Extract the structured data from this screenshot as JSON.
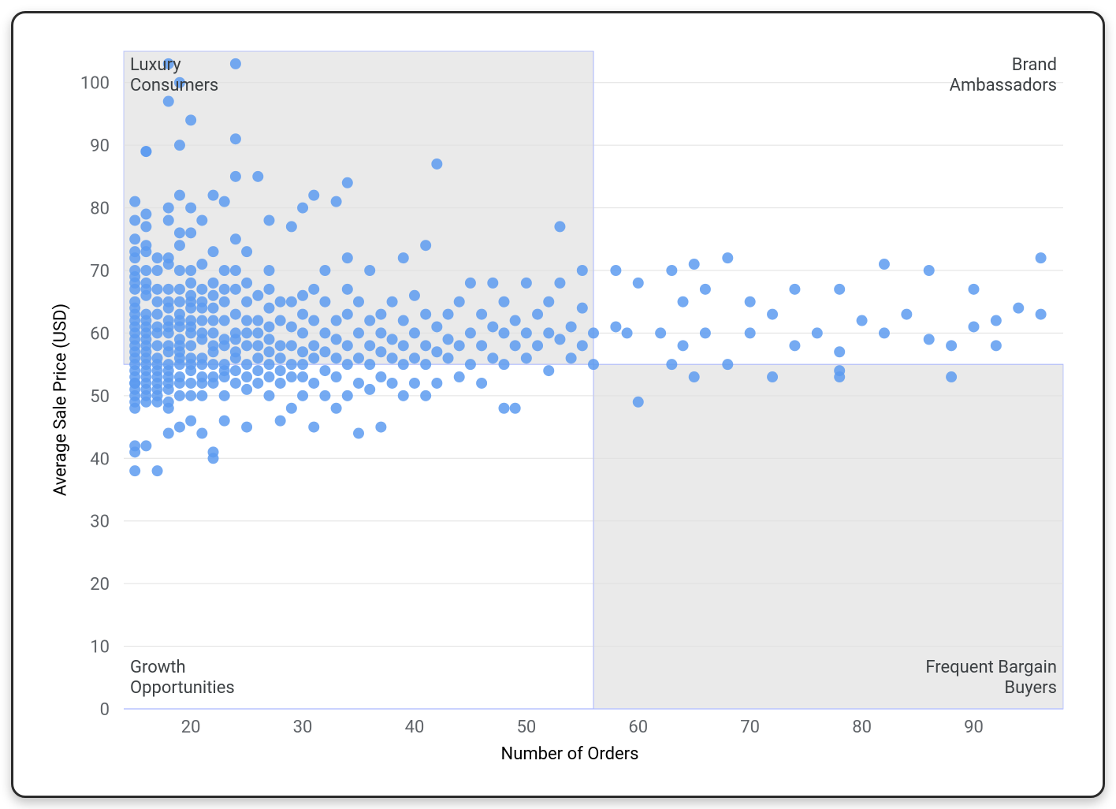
{
  "chart_data": {
    "type": "scatter",
    "xlabel": "Number of Orders",
    "ylabel": "Average Sale Price (USD)",
    "xlim": [
      14,
      98
    ],
    "ylim": [
      0,
      105
    ],
    "xticks": [
      20,
      30,
      40,
      50,
      60,
      70,
      80,
      90
    ],
    "yticks": [
      0,
      10,
      20,
      30,
      40,
      50,
      60,
      70,
      80,
      90,
      100
    ],
    "quadrant_split": {
      "x": 56,
      "y": 55
    },
    "quadrant_shading": [
      "top-left",
      "bottom-right"
    ],
    "quadrant_labels": {
      "top_left": "Luxury\nConsumers",
      "top_right": "Brand\nAmbassadors",
      "bottom_left": "Growth\nOpportunities",
      "bottom_right": "Frequent Bargain\nBuyers"
    },
    "points": [
      [
        15,
        38
      ],
      [
        15,
        41
      ],
      [
        15,
        42
      ],
      [
        15,
        48
      ],
      [
        15,
        49
      ],
      [
        15,
        50
      ],
      [
        15,
        51
      ],
      [
        15,
        52
      ],
      [
        15,
        52
      ],
      [
        15,
        53
      ],
      [
        15,
        54
      ],
      [
        15,
        55
      ],
      [
        15,
        56
      ],
      [
        15,
        57
      ],
      [
        15,
        58
      ],
      [
        15,
        59
      ],
      [
        15,
        60
      ],
      [
        15,
        61
      ],
      [
        15,
        62
      ],
      [
        15,
        63
      ],
      [
        15,
        64
      ],
      [
        15,
        65
      ],
      [
        15,
        67
      ],
      [
        15,
        68
      ],
      [
        15,
        69
      ],
      [
        15,
        70
      ],
      [
        15,
        72
      ],
      [
        15,
        73
      ],
      [
        15,
        75
      ],
      [
        15,
        78
      ],
      [
        15,
        81
      ],
      [
        16,
        42
      ],
      [
        16,
        49
      ],
      [
        16,
        50
      ],
      [
        16,
        51
      ],
      [
        16,
        52
      ],
      [
        16,
        53
      ],
      [
        16,
        54
      ],
      [
        16,
        55
      ],
      [
        16,
        56
      ],
      [
        16,
        57
      ],
      [
        16,
        58
      ],
      [
        16,
        59
      ],
      [
        16,
        60
      ],
      [
        16,
        61
      ],
      [
        16,
        62
      ],
      [
        16,
        63
      ],
      [
        16,
        66
      ],
      [
        16,
        67
      ],
      [
        16,
        68
      ],
      [
        16,
        70
      ],
      [
        16,
        73
      ],
      [
        16,
        74
      ],
      [
        16,
        77
      ],
      [
        16,
        79
      ],
      [
        16,
        89
      ],
      [
        16,
        89
      ],
      [
        17,
        38
      ],
      [
        17,
        49
      ],
      [
        17,
        50
      ],
      [
        17,
        51
      ],
      [
        17,
        52
      ],
      [
        17,
        53
      ],
      [
        17,
        54
      ],
      [
        17,
        55
      ],
      [
        17,
        56
      ],
      [
        17,
        58
      ],
      [
        17,
        60
      ],
      [
        17,
        61
      ],
      [
        17,
        63
      ],
      [
        17,
        65
      ],
      [
        17,
        67
      ],
      [
        17,
        70
      ],
      [
        17,
        72
      ],
      [
        18,
        44
      ],
      [
        18,
        48
      ],
      [
        18,
        49
      ],
      [
        18,
        51
      ],
      [
        18,
        52
      ],
      [
        18,
        53
      ],
      [
        18,
        54
      ],
      [
        18,
        55
      ],
      [
        18,
        57
      ],
      [
        18,
        58
      ],
      [
        18,
        60
      ],
      [
        18,
        61
      ],
      [
        18,
        62
      ],
      [
        18,
        64
      ],
      [
        18,
        65
      ],
      [
        18,
        67
      ],
      [
        18,
        71
      ],
      [
        18,
        72
      ],
      [
        18,
        78
      ],
      [
        18,
        80
      ],
      [
        18,
        97
      ],
      [
        18,
        103
      ],
      [
        19,
        45
      ],
      [
        19,
        50
      ],
      [
        19,
        52
      ],
      [
        19,
        53
      ],
      [
        19,
        55
      ],
      [
        19,
        56
      ],
      [
        19,
        57
      ],
      [
        19,
        58
      ],
      [
        19,
        59
      ],
      [
        19,
        61
      ],
      [
        19,
        62
      ],
      [
        19,
        63
      ],
      [
        19,
        65
      ],
      [
        19,
        67
      ],
      [
        19,
        70
      ],
      [
        19,
        74
      ],
      [
        19,
        76
      ],
      [
        19,
        82
      ],
      [
        19,
        90
      ],
      [
        19,
        100
      ],
      [
        20,
        46
      ],
      [
        20,
        50
      ],
      [
        20,
        52
      ],
      [
        20,
        54
      ],
      [
        20,
        55
      ],
      [
        20,
        56
      ],
      [
        20,
        58
      ],
      [
        20,
        60
      ],
      [
        20,
        61
      ],
      [
        20,
        62
      ],
      [
        20,
        64
      ],
      [
        20,
        65
      ],
      [
        20,
        66
      ],
      [
        20,
        68
      ],
      [
        20,
        70
      ],
      [
        20,
        76
      ],
      [
        20,
        80
      ],
      [
        20,
        94
      ],
      [
        21,
        44
      ],
      [
        21,
        50
      ],
      [
        21,
        52
      ],
      [
        21,
        53
      ],
      [
        21,
        55
      ],
      [
        21,
        56
      ],
      [
        21,
        59
      ],
      [
        21,
        60
      ],
      [
        21,
        62
      ],
      [
        21,
        64
      ],
      [
        21,
        65
      ],
      [
        21,
        67
      ],
      [
        21,
        71
      ],
      [
        21,
        78
      ],
      [
        22,
        40
      ],
      [
        22,
        41
      ],
      [
        22,
        52
      ],
      [
        22,
        53
      ],
      [
        22,
        55
      ],
      [
        22,
        57
      ],
      [
        22,
        58
      ],
      [
        22,
        60
      ],
      [
        22,
        62
      ],
      [
        22,
        64
      ],
      [
        22,
        66
      ],
      [
        22,
        68
      ],
      [
        22,
        73
      ],
      [
        22,
        82
      ],
      [
        23,
        46
      ],
      [
        23,
        50
      ],
      [
        23,
        53
      ],
      [
        23,
        54
      ],
      [
        23,
        55
      ],
      [
        23,
        58
      ],
      [
        23,
        59
      ],
      [
        23,
        62
      ],
      [
        23,
        65
      ],
      [
        23,
        67
      ],
      [
        23,
        70
      ],
      [
        23,
        81
      ],
      [
        24,
        52
      ],
      [
        24,
        54
      ],
      [
        24,
        56
      ],
      [
        24,
        57
      ],
      [
        24,
        59
      ],
      [
        24,
        60
      ],
      [
        24,
        63
      ],
      [
        24,
        67
      ],
      [
        24,
        70
      ],
      [
        24,
        75
      ],
      [
        24,
        85
      ],
      [
        24,
        91
      ],
      [
        24,
        103
      ],
      [
        25,
        45
      ],
      [
        25,
        51
      ],
      [
        25,
        53
      ],
      [
        25,
        55
      ],
      [
        25,
        58
      ],
      [
        25,
        60
      ],
      [
        25,
        62
      ],
      [
        25,
        65
      ],
      [
        25,
        68
      ],
      [
        25,
        73
      ],
      [
        26,
        52
      ],
      [
        26,
        54
      ],
      [
        26,
        56
      ],
      [
        26,
        58
      ],
      [
        26,
        60
      ],
      [
        26,
        62
      ],
      [
        26,
        66
      ],
      [
        26,
        85
      ],
      [
        27,
        50
      ],
      [
        27,
        53
      ],
      [
        27,
        55
      ],
      [
        27,
        57
      ],
      [
        27,
        59
      ],
      [
        27,
        61
      ],
      [
        27,
        64
      ],
      [
        27,
        67
      ],
      [
        27,
        70
      ],
      [
        27,
        78
      ],
      [
        28,
        46
      ],
      [
        28,
        52
      ],
      [
        28,
        54
      ],
      [
        28,
        56
      ],
      [
        28,
        58
      ],
      [
        28,
        62
      ],
      [
        28,
        65
      ],
      [
        29,
        48
      ],
      [
        29,
        53
      ],
      [
        29,
        55
      ],
      [
        29,
        58
      ],
      [
        29,
        61
      ],
      [
        29,
        65
      ],
      [
        29,
        77
      ],
      [
        30,
        50
      ],
      [
        30,
        53
      ],
      [
        30,
        55
      ],
      [
        30,
        57
      ],
      [
        30,
        60
      ],
      [
        30,
        63
      ],
      [
        30,
        66
      ],
      [
        30,
        80
      ],
      [
        31,
        45
      ],
      [
        31,
        52
      ],
      [
        31,
        56
      ],
      [
        31,
        58
      ],
      [
        31,
        62
      ],
      [
        31,
        67
      ],
      [
        31,
        82
      ],
      [
        32,
        50
      ],
      [
        32,
        54
      ],
      [
        32,
        57
      ],
      [
        32,
        60
      ],
      [
        32,
        65
      ],
      [
        32,
        70
      ],
      [
        33,
        48
      ],
      [
        33,
        53
      ],
      [
        33,
        56
      ],
      [
        33,
        59
      ],
      [
        33,
        62
      ],
      [
        33,
        81
      ],
      [
        34,
        50
      ],
      [
        34,
        55
      ],
      [
        34,
        58
      ],
      [
        34,
        63
      ],
      [
        34,
        67
      ],
      [
        34,
        72
      ],
      [
        34,
        84
      ],
      [
        35,
        44
      ],
      [
        35,
        52
      ],
      [
        35,
        56
      ],
      [
        35,
        60
      ],
      [
        35,
        65
      ],
      [
        36,
        51
      ],
      [
        36,
        55
      ],
      [
        36,
        58
      ],
      [
        36,
        62
      ],
      [
        36,
        70
      ],
      [
        37,
        45
      ],
      [
        37,
        53
      ],
      [
        37,
        57
      ],
      [
        37,
        60
      ],
      [
        37,
        63
      ],
      [
        38,
        52
      ],
      [
        38,
        56
      ],
      [
        38,
        59
      ],
      [
        38,
        65
      ],
      [
        39,
        50
      ],
      [
        39,
        55
      ],
      [
        39,
        58
      ],
      [
        39,
        62
      ],
      [
        39,
        72
      ],
      [
        40,
        52
      ],
      [
        40,
        56
      ],
      [
        40,
        60
      ],
      [
        40,
        66
      ],
      [
        41,
        50
      ],
      [
        41,
        55
      ],
      [
        41,
        58
      ],
      [
        41,
        63
      ],
      [
        41,
        74
      ],
      [
        42,
        52
      ],
      [
        42,
        57
      ],
      [
        42,
        61
      ],
      [
        42,
        87
      ],
      [
        43,
        56
      ],
      [
        43,
        59
      ],
      [
        43,
        63
      ],
      [
        44,
        53
      ],
      [
        44,
        58
      ],
      [
        44,
        65
      ],
      [
        45,
        55
      ],
      [
        45,
        60
      ],
      [
        45,
        68
      ],
      [
        46,
        52
      ],
      [
        46,
        58
      ],
      [
        46,
        63
      ],
      [
        47,
        56
      ],
      [
        47,
        61
      ],
      [
        47,
        68
      ],
      [
        48,
        48
      ],
      [
        48,
        55
      ],
      [
        48,
        60
      ],
      [
        48,
        65
      ],
      [
        49,
        48
      ],
      [
        49,
        58
      ],
      [
        49,
        62
      ],
      [
        50,
        56
      ],
      [
        50,
        60
      ],
      [
        50,
        68
      ],
      [
        51,
        58
      ],
      [
        51,
        63
      ],
      [
        52,
        54
      ],
      [
        52,
        60
      ],
      [
        52,
        65
      ],
      [
        53,
        59
      ],
      [
        53,
        68
      ],
      [
        53,
        77
      ],
      [
        54,
        56
      ],
      [
        54,
        61
      ],
      [
        55,
        58
      ],
      [
        55,
        64
      ],
      [
        55,
        70
      ],
      [
        56,
        55
      ],
      [
        56,
        60
      ],
      [
        58,
        61
      ],
      [
        58,
        70
      ],
      [
        59,
        60
      ],
      [
        60,
        49
      ],
      [
        60,
        68
      ],
      [
        62,
        60
      ],
      [
        63,
        55
      ],
      [
        63,
        70
      ],
      [
        64,
        58
      ],
      [
        64,
        65
      ],
      [
        65,
        53
      ],
      [
        65,
        71
      ],
      [
        66,
        60
      ],
      [
        66,
        67
      ],
      [
        68,
        55
      ],
      [
        68,
        72
      ],
      [
        70,
        60
      ],
      [
        70,
        65
      ],
      [
        72,
        53
      ],
      [
        72,
        63
      ],
      [
        74,
        58
      ],
      [
        74,
        67
      ],
      [
        76,
        60
      ],
      [
        78,
        53
      ],
      [
        78,
        54
      ],
      [
        78,
        57
      ],
      [
        78,
        67
      ],
      [
        80,
        62
      ],
      [
        82,
        60
      ],
      [
        82,
        71
      ],
      [
        84,
        63
      ],
      [
        86,
        59
      ],
      [
        86,
        70
      ],
      [
        88,
        53
      ],
      [
        88,
        58
      ],
      [
        90,
        61
      ],
      [
        90,
        67
      ],
      [
        92,
        58
      ],
      [
        92,
        62
      ],
      [
        94,
        64
      ],
      [
        96,
        63
      ],
      [
        96,
        72
      ]
    ]
  }
}
